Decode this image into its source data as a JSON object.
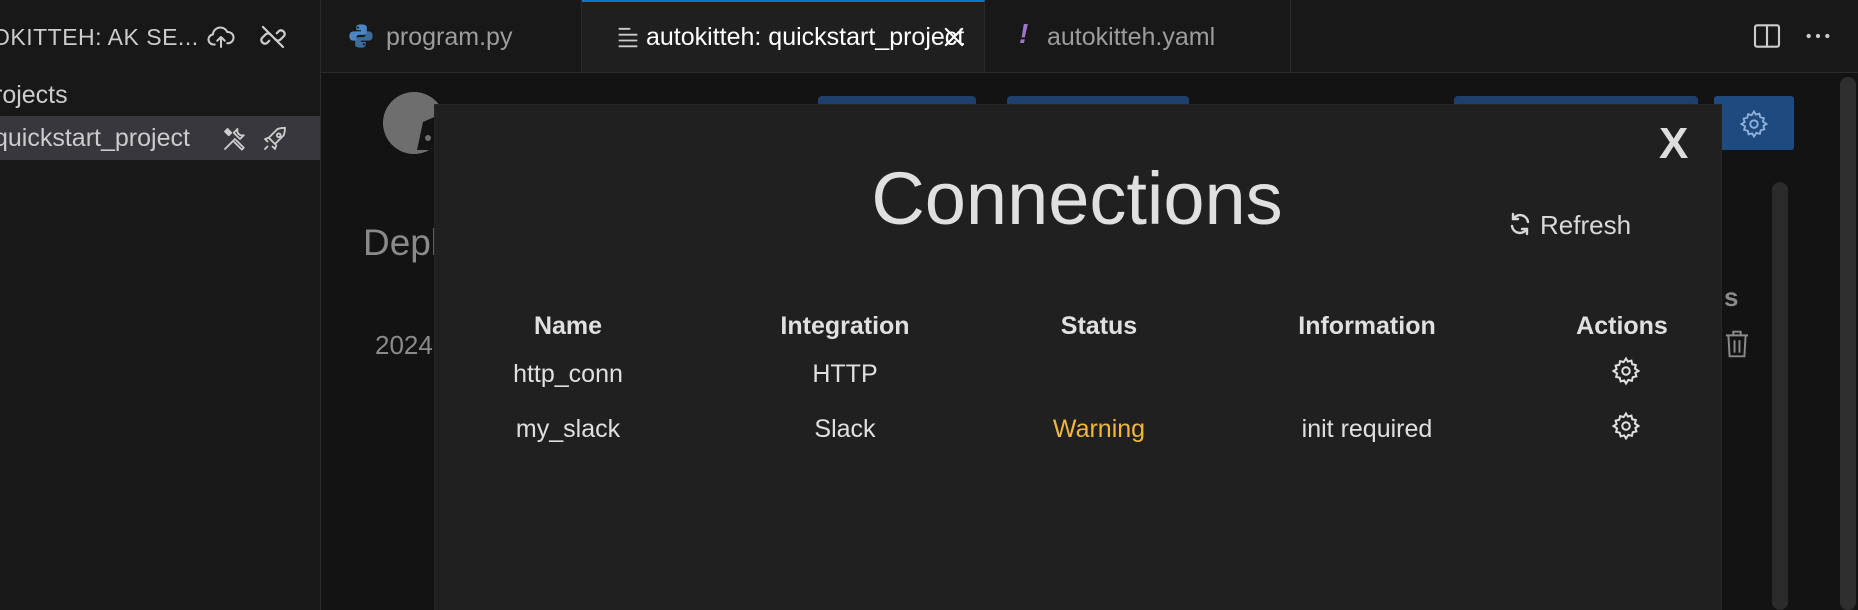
{
  "sidebar": {
    "title": "OKITTEH: AK SE...",
    "section_label": "rojects",
    "project_label": "quickstart_project"
  },
  "tabs": [
    {
      "label": "program.py",
      "icon": "python-icon"
    },
    {
      "label": "autokitteh: quickstart_project",
      "icon": "preview-icon",
      "active": true
    },
    {
      "label": "autokitteh.yaml",
      "icon": "exclamation-icon"
    }
  ],
  "background": {
    "title": "Depl",
    "date": "2024",
    "column_fragment": "s"
  },
  "modal": {
    "close_label": "X",
    "title": "Connections",
    "refresh_label": "Refresh",
    "columns": [
      "Name",
      "Integration",
      "Status",
      "Information",
      "Actions"
    ],
    "rows": [
      {
        "name": "http_conn",
        "integration": "HTTP",
        "status": "",
        "information": ""
      },
      {
        "name": "my_slack",
        "integration": "Slack",
        "status": "Warning",
        "information": "init required"
      }
    ]
  },
  "colors": {
    "accent": "#0078d4",
    "warning": "#f0b73a",
    "button_blue": "#1f3f6d"
  }
}
